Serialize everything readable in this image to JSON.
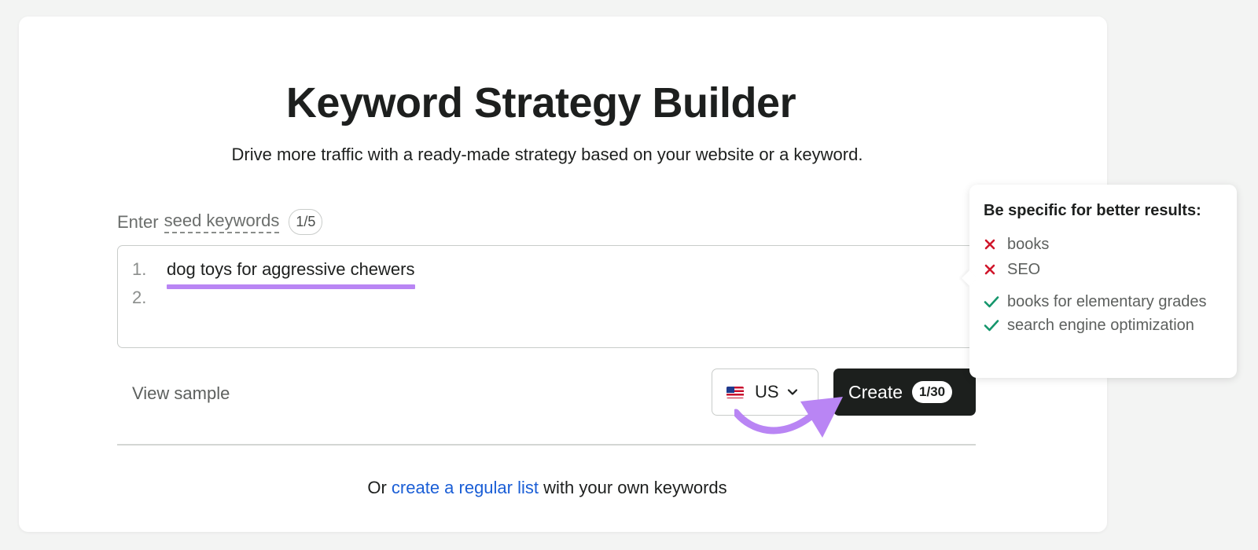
{
  "header": {
    "title": "Keyword Strategy Builder",
    "subtitle": "Drive more traffic with a ready-made strategy based on your website or a keyword."
  },
  "seed": {
    "label_prefix": "Enter",
    "label_link": "seed keywords",
    "count": "1/5",
    "lines": [
      {
        "number": "1.",
        "text": "dog toys for aggressive chewers"
      },
      {
        "number": "2.",
        "text": ""
      }
    ]
  },
  "actions": {
    "view_sample": "View sample",
    "country_code": "US",
    "flag_icon": "us-flag-icon",
    "create_label": "Create",
    "create_count": "1/30"
  },
  "footer": {
    "prefix": "Or",
    "link": "create a regular list",
    "suffix": "with your own keywords"
  },
  "tip": {
    "title": "Be specific for better results:",
    "bad_examples": [
      "books",
      "SEO"
    ],
    "good_examples": [
      "books for elementary grades",
      "search engine optimization"
    ]
  },
  "colors": {
    "accent_highlight": "#b985f4",
    "link": "#1a5ed6",
    "create_button": "#1c1f1d",
    "bad_icon": "#d0162b",
    "good_icon": "#15966c"
  }
}
